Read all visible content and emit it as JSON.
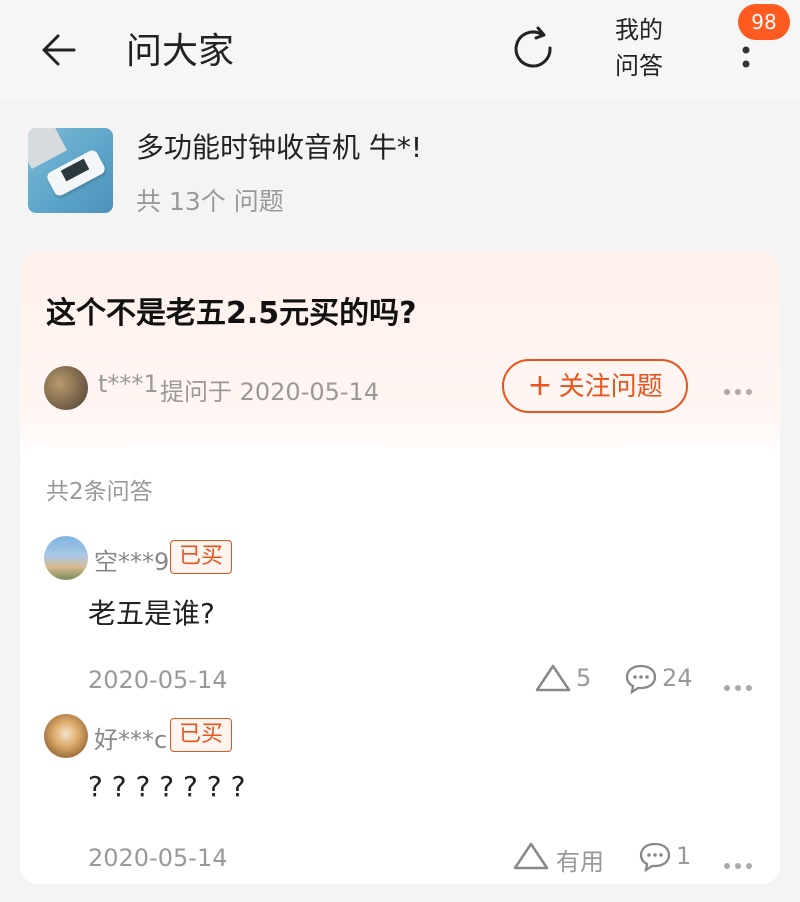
{
  "header": {
    "title": "问大家",
    "my_qa_line1": "我的",
    "my_qa_line2": "问答",
    "badge_count": "98",
    "back_icon": "arrow-left-icon",
    "refresh_icon": "refresh-icon",
    "more_icon": "vertical-dots-icon"
  },
  "product": {
    "name": "多功能时钟收音机 牛*!",
    "question_count": "共 13个 问题"
  },
  "question": {
    "text": "这个不是老五2.5元买的吗?",
    "asker": "t***1",
    "asked_at": "提问于 2020-05-14",
    "follow_label": "关注问题",
    "follow_plus": "+"
  },
  "answers_section": {
    "count_label": "共2条问答",
    "items": [
      {
        "user": "空***9",
        "bought_badge": "已买",
        "text": "老五是谁?",
        "date": "2020-05-14",
        "likes": "5",
        "comments": "24"
      },
      {
        "user": "好***c",
        "bought_badge": "已买",
        "text": "? ? ? ? ? ? ?",
        "date": "2020-05-14",
        "likes": "有用",
        "comments": "1"
      }
    ]
  },
  "colors": {
    "accent": "#e8541d",
    "badge": "#ff5a1f",
    "muted_text": "#999999"
  }
}
